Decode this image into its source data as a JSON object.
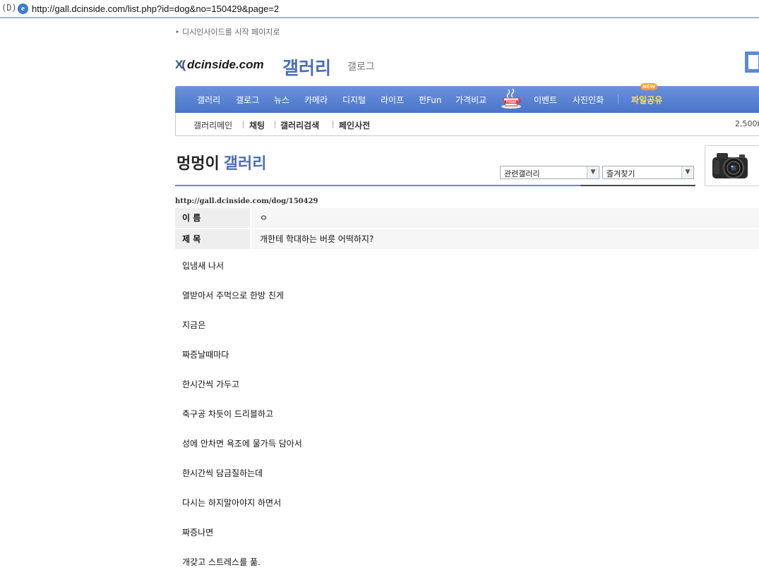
{
  "browser": {
    "drive_icon": "(D)",
    "url": "http://gall.dcinside.com/list.php?id=dog&no=150429&page=2"
  },
  "header": {
    "start_page_link": "디시인사이드를 시작 페이지로",
    "logo_mark": "X(",
    "logo_text": "dcinside.com",
    "logo_gallery": "갤러리",
    "gallog": "갤로그"
  },
  "nav": {
    "items": [
      "갤러리",
      "갤로그",
      "뉴스",
      "카메라",
      "디지털",
      "라이프",
      "펀Fun",
      "가격비교",
      "이벤트",
      "사진인화"
    ],
    "file_share": "파일공유",
    "new_badge": "NEW",
    "today_icon": "today-cup-icon"
  },
  "subnav": {
    "items": [
      "갤러리메인",
      "채팅",
      "갤러리검색",
      "페인사전"
    ],
    "count": "2,500",
    "count_suffix": "b"
  },
  "gallery": {
    "title_a": "멍멍이",
    "title_b": "갤러리",
    "related_select": "관련갤러리",
    "favorites_select": "즐겨찾기"
  },
  "post": {
    "url": "http://gall.dcinside.com/dog/150429",
    "name_label": "이 름",
    "name_value": "ㅇ",
    "subject_label": "제 목",
    "subject_value": "개한테 학대하는 버릇 어떡하지?",
    "body": [
      "입냄새 나서",
      "열받아서 주먹으로 한방 친게",
      "지금은",
      "짜증날때마다",
      "한시간씩 가두고",
      "축구공 차듯이 드리블하고",
      "성에 안차면 욕조에 물가득 담아서",
      "한시간씩 담금질하는데",
      "다시는 하지말아야지 하면서",
      "짜증나면",
      "개갖고 스트레스를 풂."
    ]
  },
  "colors": {
    "nav_blue": "#4a74c8",
    "brand_blue": "#4c6db8",
    "file_share_yellow": "#ffe25a"
  }
}
